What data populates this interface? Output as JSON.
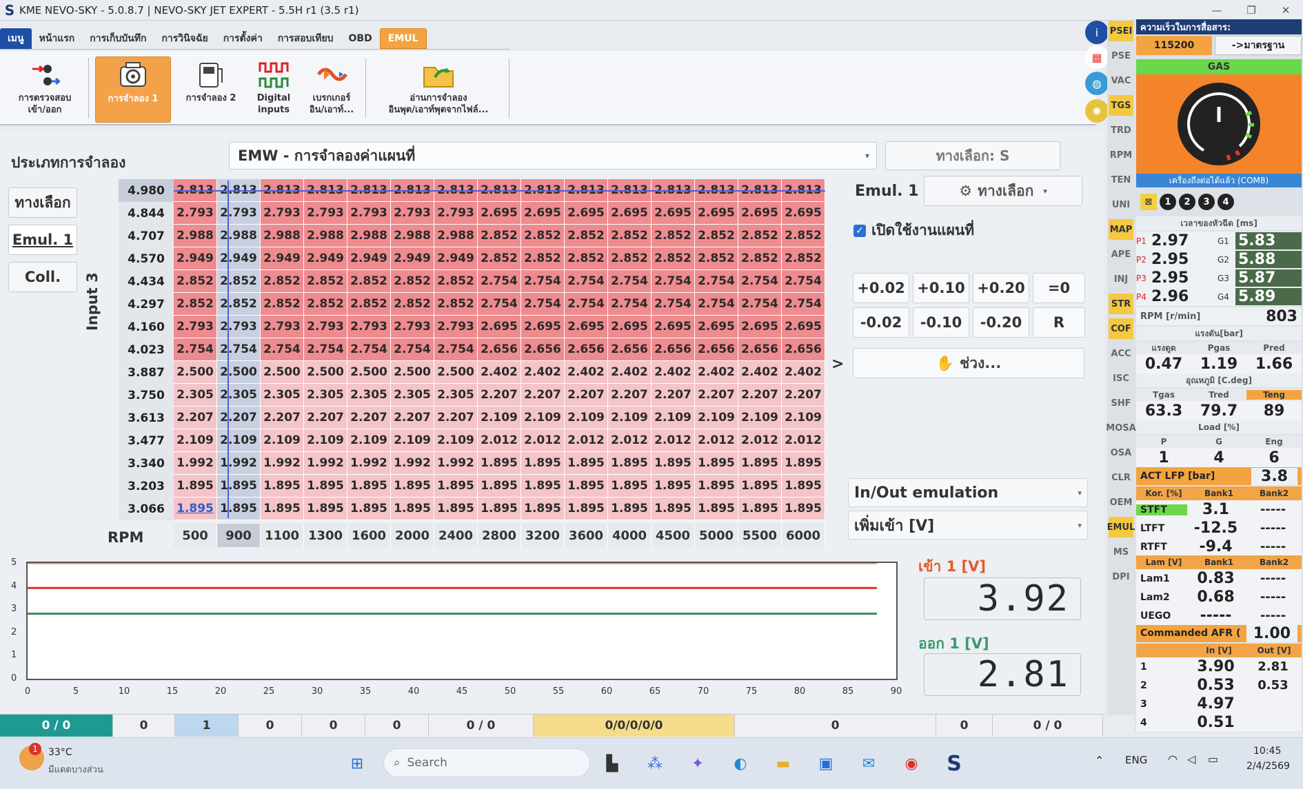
{
  "window": {
    "title": "KME NEVO-SKY - 5.0.8.7  |  NEVO-SKY JET EXPERT - 5.5H r1 (3.5 r1)",
    "logo": "S"
  },
  "menu": [
    "เมนู",
    "หน้าแรก",
    "การเก็บบันทึก",
    "การวินิจฉัย",
    "การตั้งค่า",
    "การสอบเทียบ",
    "OBD",
    "EMUL"
  ],
  "ribbon": [
    {
      "label": "การตรวจสอบ\nเข้า/ออก",
      "icon": "io-check-icon"
    },
    {
      "label": "การจำลอง 1",
      "icon": "emulation-1-icon",
      "selected": true
    },
    {
      "label": "การจำลอง 2",
      "icon": "emulation-2-icon"
    },
    {
      "label": "Digital\ninputs",
      "icon": "digital-inputs-icon"
    },
    {
      "label": "เบรกเกอร์\nอิน/เอาท์...",
      "icon": "breaker-icon"
    },
    {
      "label": "อ่านการจำลอง\nอินพุต/เอาท์พุตจากไฟล์...",
      "icon": "read-file-icon"
    }
  ],
  "sim": {
    "type_label": "ประเภทการจำลอง",
    "combo_value": "EMW  - การจำลองค่าแผนที่",
    "option_s": "ทางเลือก: S"
  },
  "side_buttons": [
    "ทางเลือก",
    "Emul. 1",
    "Coll."
  ],
  "map": {
    "y_axis_label": "Input 3",
    "x_axis_label": "RPM",
    "rows": [
      "4.980",
      "4.844",
      "4.707",
      "4.570",
      "4.434",
      "4.297",
      "4.160",
      "4.023",
      "3.887",
      "3.750",
      "3.613",
      "3.477",
      "3.340",
      "3.203",
      "3.066"
    ],
    "cols": [
      "500",
      "900",
      "1100",
      "1300",
      "1600",
      "2000",
      "2400",
      "2800",
      "3200",
      "3600",
      "4000",
      "4500",
      "5000",
      "5500",
      "6000"
    ],
    "values": [
      [
        "2.813",
        "2.813",
        "2.813",
        "2.813",
        "2.813",
        "2.813",
        "2.813",
        "2.813",
        "2.813",
        "2.813",
        "2.813",
        "2.813",
        "2.813",
        "2.813",
        "2.813"
      ],
      [
        "2.793",
        "2.793",
        "2.793",
        "2.793",
        "2.793",
        "2.793",
        "2.793",
        "2.695",
        "2.695",
        "2.695",
        "2.695",
        "2.695",
        "2.695",
        "2.695",
        "2.695"
      ],
      [
        "2.988",
        "2.988",
        "2.988",
        "2.988",
        "2.988",
        "2.988",
        "2.988",
        "2.852",
        "2.852",
        "2.852",
        "2.852",
        "2.852",
        "2.852",
        "2.852",
        "2.852"
      ],
      [
        "2.949",
        "2.949",
        "2.949",
        "2.949",
        "2.949",
        "2.949",
        "2.949",
        "2.852",
        "2.852",
        "2.852",
        "2.852",
        "2.852",
        "2.852",
        "2.852",
        "2.852"
      ],
      [
        "2.852",
        "2.852",
        "2.852",
        "2.852",
        "2.852",
        "2.852",
        "2.852",
        "2.754",
        "2.754",
        "2.754",
        "2.754",
        "2.754",
        "2.754",
        "2.754",
        "2.754"
      ],
      [
        "2.852",
        "2.852",
        "2.852",
        "2.852",
        "2.852",
        "2.852",
        "2.852",
        "2.754",
        "2.754",
        "2.754",
        "2.754",
        "2.754",
        "2.754",
        "2.754",
        "2.754"
      ],
      [
        "2.793",
        "2.793",
        "2.793",
        "2.793",
        "2.793",
        "2.793",
        "2.793",
        "2.695",
        "2.695",
        "2.695",
        "2.695",
        "2.695",
        "2.695",
        "2.695",
        "2.695"
      ],
      [
        "2.754",
        "2.754",
        "2.754",
        "2.754",
        "2.754",
        "2.754",
        "2.754",
        "2.656",
        "2.656",
        "2.656",
        "2.656",
        "2.656",
        "2.656",
        "2.656",
        "2.656"
      ],
      [
        "2.500",
        "2.500",
        "2.500",
        "2.500",
        "2.500",
        "2.500",
        "2.500",
        "2.402",
        "2.402",
        "2.402",
        "2.402",
        "2.402",
        "2.402",
        "2.402",
        "2.402"
      ],
      [
        "2.305",
        "2.305",
        "2.305",
        "2.305",
        "2.305",
        "2.305",
        "2.305",
        "2.207",
        "2.207",
        "2.207",
        "2.207",
        "2.207",
        "2.207",
        "2.207",
        "2.207"
      ],
      [
        "2.207",
        "2.207",
        "2.207",
        "2.207",
        "2.207",
        "2.207",
        "2.207",
        "2.109",
        "2.109",
        "2.109",
        "2.109",
        "2.109",
        "2.109",
        "2.109",
        "2.109"
      ],
      [
        "2.109",
        "2.109",
        "2.109",
        "2.109",
        "2.109",
        "2.109",
        "2.109",
        "2.012",
        "2.012",
        "2.012",
        "2.012",
        "2.012",
        "2.012",
        "2.012",
        "2.012"
      ],
      [
        "1.992",
        "1.992",
        "1.992",
        "1.992",
        "1.992",
        "1.992",
        "1.992",
        "1.895",
        "1.895",
        "1.895",
        "1.895",
        "1.895",
        "1.895",
        "1.895",
        "1.895"
      ],
      [
        "1.895",
        "1.895",
        "1.895",
        "1.895",
        "1.895",
        "1.895",
        "1.895",
        "1.895",
        "1.895",
        "1.895",
        "1.895",
        "1.895",
        "1.895",
        "1.895",
        "1.895"
      ],
      [
        "1.895",
        "1.895",
        "1.895",
        "1.895",
        "1.895",
        "1.895",
        "1.895",
        "1.895",
        "1.895",
        "1.895",
        "1.895",
        "1.895",
        "1.895",
        "1.895",
        "1.895"
      ]
    ],
    "highlight_row": 0,
    "highlight_col": 1
  },
  "emul_panel": {
    "title": "Emul. 1",
    "option_btn": "ทางเลือก",
    "enable_label": "เปิดใช้งานแผนที่",
    "enabled": true,
    "steps_plus": [
      "+0.02",
      "+0.10",
      "+0.20",
      "=0"
    ],
    "steps_minus": [
      "-0.02",
      "-0.10",
      "-0.20",
      "R"
    ],
    "range_btn": "ช่วง...",
    "arrow": ">",
    "io_emulation": "In/Out emulation",
    "input_v": "เพิ่มเข้า [V]"
  },
  "chart_data": {
    "type": "line",
    "xlim": [
      0,
      90
    ],
    "ylim": [
      0,
      5
    ],
    "xticks": [
      "0",
      "5",
      "10",
      "15",
      "20",
      "25",
      "30",
      "35",
      "40",
      "45",
      "50",
      "55",
      "60",
      "65",
      "70",
      "75",
      "80",
      "85",
      "90"
    ],
    "yticks": [
      "0",
      "1",
      "2",
      "3",
      "4",
      "5"
    ],
    "series": [
      {
        "color": "#f08a2a",
        "x": [
          0,
          88
        ],
        "y": [
          5,
          5
        ]
      },
      {
        "color": "#d9342b",
        "x": [
          0,
          88
        ],
        "y": [
          3.92,
          3.92
        ]
      },
      {
        "color": "#3a8a5a",
        "x": [
          0,
          88
        ],
        "y": [
          2.81,
          2.81
        ]
      }
    ]
  },
  "readouts": {
    "in_label": "เข้า 1 [V]",
    "in_value": "3.92",
    "out_label": "ออก 1 [V]",
    "out_value": "2.81"
  },
  "status": [
    "0 / 0",
    "0",
    "1",
    "0",
    "0",
    "0",
    "0 / 0",
    "0/0/0/0/0",
    "0",
    "0",
    "0 / 0"
  ],
  "vlist": [
    "PSEI",
    "PSE",
    "VAC",
    "TGS",
    "TRD",
    "RPM",
    "TEN",
    "UNI",
    "MAP",
    "APE",
    "INJ",
    "STR",
    "COF",
    "ACC",
    "ISC",
    "SHF",
    "MOSA",
    "OSA",
    "CLR",
    "OEM",
    "EMUL",
    "MS",
    "DPI"
  ],
  "right_panel": {
    "comm_speed_label": "ความเร็วในการสื่อสาร:",
    "baud": "115200",
    "std_btn": "->มาตรฐาน",
    "gas": "GAS",
    "connected": "เครื่องถึงต่อได้แล้ว (COM8)",
    "cyl_buttons": [
      "1",
      "2",
      "3",
      "4"
    ],
    "inj_header": "เวลาของหัวฉีด [ms]",
    "p": [
      {
        "k": "P1",
        "v": "2.97"
      },
      {
        "k": "P2",
        "v": "2.95"
      },
      {
        "k": "P3",
        "v": "2.95"
      },
      {
        "k": "P4",
        "v": "2.96"
      }
    ],
    "g": [
      {
        "k": "G1",
        "v": "5.83"
      },
      {
        "k": "G2",
        "v": "5.88"
      },
      {
        "k": "G3",
        "v": "5.87"
      },
      {
        "k": "G4",
        "v": "5.89"
      }
    ],
    "rpm_label": "RPM [r/min]",
    "rpm": "803",
    "pressure_header": "แรงดัน[bar]",
    "pressure_cols": [
      "แรงดูด",
      "Pgas",
      "Pred"
    ],
    "pressure_vals": [
      "0.47",
      "1.19",
      "1.66"
    ],
    "temp_header": "อุณหภูมิ [C.deg]",
    "temp_cols": [
      "Tgas",
      "Tred",
      "Teng"
    ],
    "temp_vals": [
      "63.3",
      "79.7",
      "89"
    ],
    "load_header": "Load [%]",
    "load_cols": [
      "P",
      "G",
      "Eng"
    ],
    "load_vals": [
      "1",
      "4",
      "6"
    ],
    "act_lfp_label": "ACT LFP [bar]",
    "act_lfp": "3.8",
    "kor_header": [
      "Kor. [%]",
      "Bank1",
      "Bank2"
    ],
    "kor": [
      {
        "k": "STFT",
        "v": "3.1",
        "v2": "-----"
      },
      {
        "k": "LTFT",
        "v": "-12.5",
        "v2": "-----"
      },
      {
        "k": "RTFT",
        "v": "-9.4",
        "v2": "-----"
      }
    ],
    "lam_header": [
      "Lam [V]",
      "Bank1",
      "Bank2"
    ],
    "lam": [
      {
        "k": "Lam1",
        "v": "0.83",
        "v2": "-----"
      },
      {
        "k": "Lam2",
        "v": "0.68",
        "v2": "-----"
      },
      {
        "k": "UEGO",
        "v": "-----",
        "v2": "-----"
      }
    ],
    "afr_label": "Commanded AFR (",
    "afr": "1.00",
    "io_header": [
      "",
      "In [V]",
      "Out [V]"
    ],
    "io": [
      {
        "k": "1",
        "v": "3.90",
        "v2": "2.81"
      },
      {
        "k": "2",
        "v": "0.53",
        "v2": "0.53"
      },
      {
        "k": "3",
        "v": "4.97",
        "v2": ""
      },
      {
        "k": "4",
        "v": "0.51",
        "v2": ""
      }
    ]
  },
  "taskbar": {
    "weather_temp": "33°C",
    "weather_text": "มีแดดบางส่วน",
    "search": "Search",
    "lang": "ENG",
    "time": "10:45",
    "date": "2/4/2569",
    "notif": "1"
  }
}
